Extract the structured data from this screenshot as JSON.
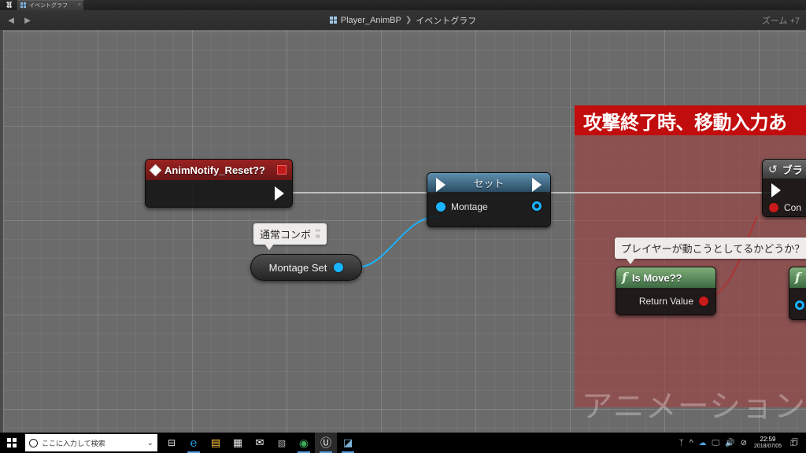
{
  "window": {
    "app_logo": "unreal-logo",
    "tab": {
      "label": "イベントグラフ",
      "icon": "blueprint-grid-icon",
      "close": "×"
    }
  },
  "toolbar": {
    "back_icon": "◄",
    "forward_icon": "►",
    "breadcrumb": {
      "icon": "blueprint-grid-icon",
      "root": "Player_AnimBP",
      "separator": "❯",
      "current": "イベントグラフ"
    },
    "zoom_label": "ズーム +7"
  },
  "graph": {
    "watermark": "アニメーション",
    "comment": {
      "title": "攻撃終了時、移動入力あ",
      "color": "#c10d0d",
      "fill": "rgba(168,58,58,0.52)"
    },
    "nodes": {
      "anim_notify": {
        "title": "AnimNotify_Reset??",
        "icon": "event-diamond-icon",
        "badge": "red-square-icon",
        "exec_out": "exec-out-pin"
      },
      "set_node": {
        "title": "セット",
        "exec_in": "exec-in-pin",
        "exec_out": "exec-out-pin",
        "pin_in_label": "Montage",
        "pin_in_color": "#18b4ff",
        "pin_out_color": "#18b4ff"
      },
      "montage_set_var": {
        "label": "Montage Set",
        "pin_color": "#18b4ff",
        "bubble": "通常コンボ"
      },
      "is_move_fn": {
        "title": "Is Move??",
        "fn_glyph": "f",
        "return_label": "Return Value",
        "return_color": "#c81a1a",
        "bubble": "プレイヤーが動こうとしてるかどうか？"
      },
      "branch_node": {
        "title": "ブラ",
        "icon": "branch-icon",
        "condition_label": "Con",
        "condition_color": "#c81a1a"
      },
      "right_fn": {
        "fn_glyph": "f",
        "pin_color": "#18b4ff"
      }
    }
  },
  "taskbar": {
    "start": "windows-logo",
    "search": {
      "placeholder": "ここに入力して検索",
      "icon": "search-circle-icon",
      "mic": "🎤"
    },
    "task_view": "⊟",
    "apps": [
      {
        "name": "edge",
        "glyph": "e",
        "color": "#1b9de2"
      },
      {
        "name": "file-explorer",
        "glyph": "▤",
        "color": "#ffc83d"
      },
      {
        "name": "microsoft-store",
        "glyph": "▦",
        "color": "#e8e8e8"
      },
      {
        "name": "mail",
        "glyph": "✉",
        "color": "#ffffff"
      },
      {
        "name": "visual-studio",
        "glyph": "▧",
        "color": "#b8b8b8"
      },
      {
        "name": "chrome",
        "glyph": "◉",
        "color": "#3ba95a"
      },
      {
        "name": "unreal-engine",
        "glyph": "Ⓤ",
        "color": "#e6e6e6"
      },
      {
        "name": "unknown-app",
        "glyph": "◪",
        "color": "#7fb4d8"
      }
    ],
    "tray": [
      "ᛉ",
      "^",
      "☁",
      "🖵",
      "🔊",
      "⊘"
    ],
    "clock": {
      "time": "22:59",
      "date": "2018/07/05"
    },
    "notifications": "🗊"
  }
}
